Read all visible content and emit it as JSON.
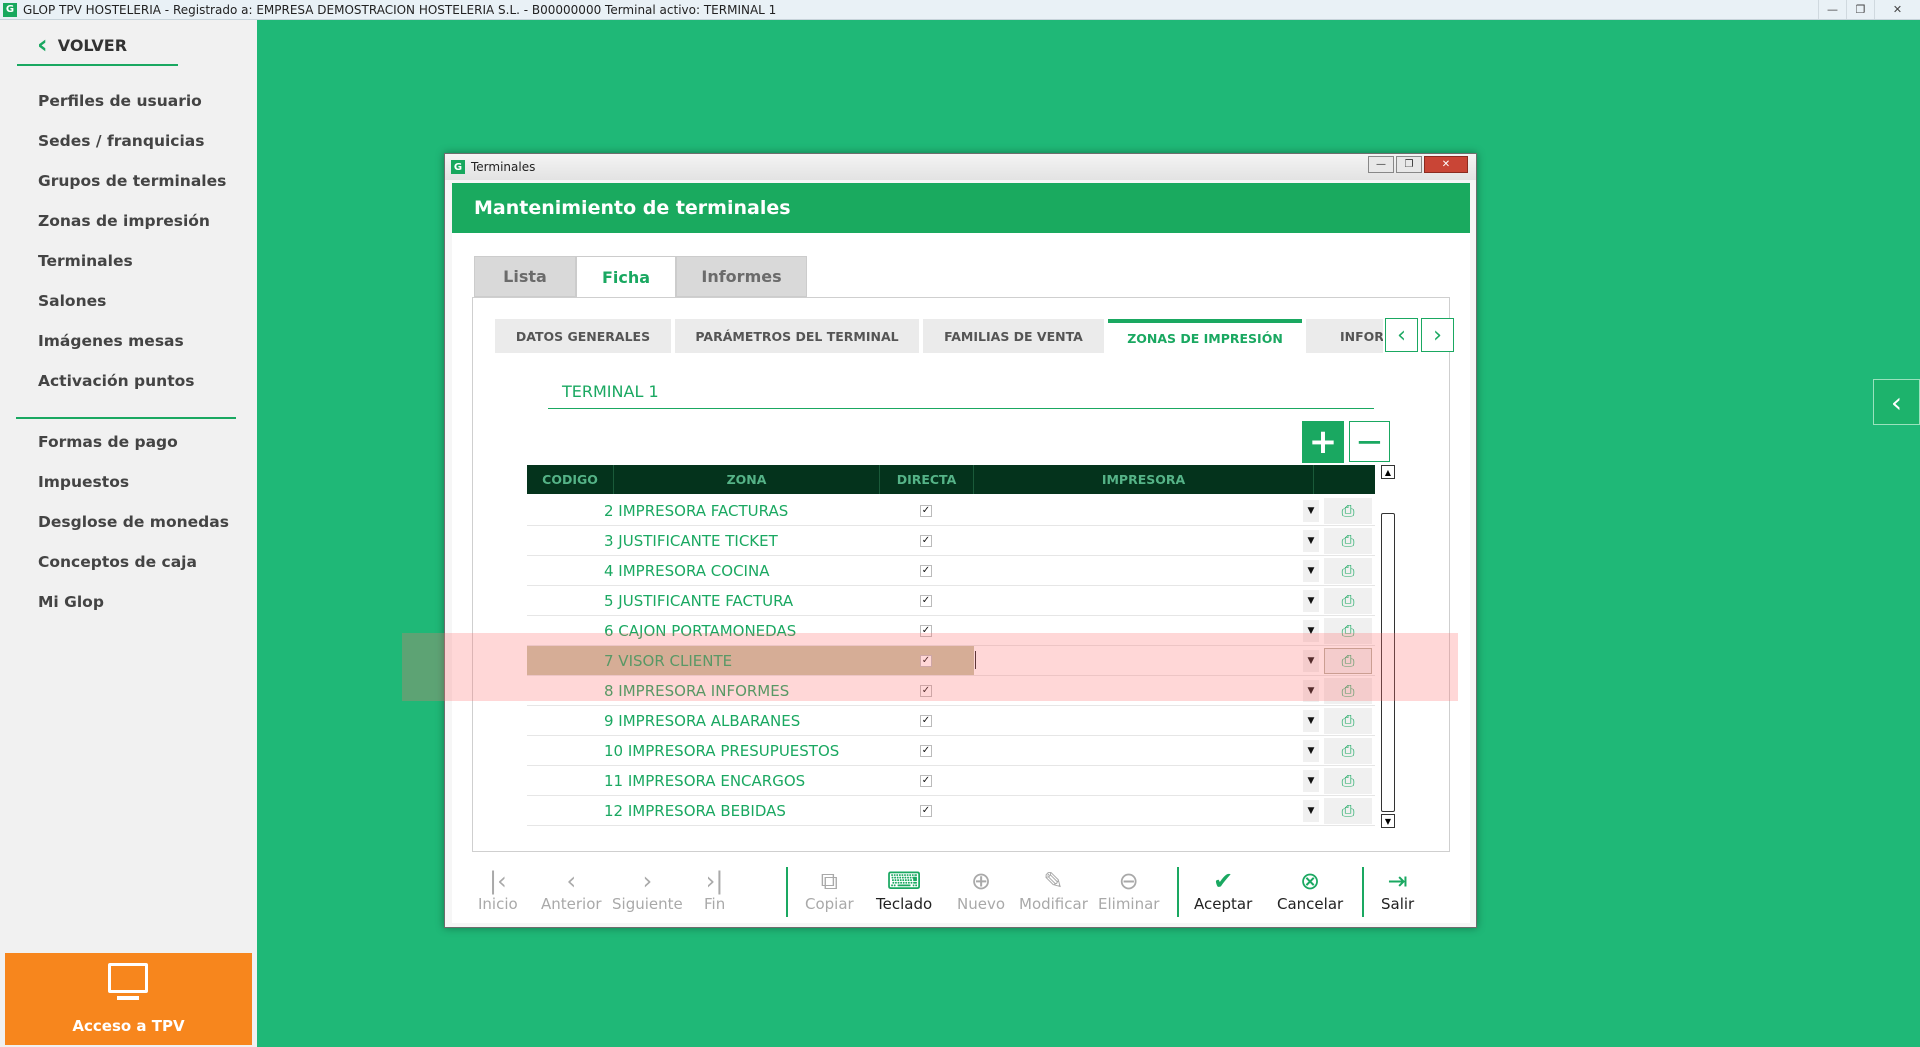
{
  "window": {
    "title": "GLOP TPV HOSTELERIA -  Registrado a: EMPRESA DEMOSTRACION  HOSTELERIA S.L. - B00000000  Terminal activo: TERMINAL 1",
    "app_icon": "G",
    "minimize": "—",
    "maximize": "❐",
    "close": "✕"
  },
  "sidebar": {
    "back_label": "VOLVER",
    "group1": [
      "Perfiles de usuario",
      "Sedes / franquicias",
      "Grupos de terminales",
      "Zonas de impresión",
      "Terminales",
      "Salones",
      "Imágenes mesas",
      "Activación puntos"
    ],
    "group2": [
      "Formas de pago",
      "Impuestos",
      "Desglose de monedas",
      "Conceptos de caja",
      "Mi Glop"
    ],
    "tpv_label": "Acceso a TPV"
  },
  "dialog": {
    "title": "Terminales",
    "app_icon": "G",
    "header": "Mantenimiento de terminales",
    "main_tabs": [
      "Lista",
      "Ficha",
      "Informes"
    ],
    "active_main_tab": "Ficha",
    "sub_tabs": [
      "DATOS GENERALES",
      "PARÁMETROS DEL TERMINAL",
      "FAMILIAS DE VENTA",
      "ZONAS DE IMPRESIÓN",
      "INFORM"
    ],
    "active_sub_tab": "ZONAS DE IMPRESIÓN",
    "terminal_name": "TERMINAL 1",
    "grid": {
      "columns": [
        "CODIGO",
        "ZONA",
        "DIRECTA",
        "IMPRESORA"
      ],
      "rows": [
        {
          "zona": "2 IMPRESORA FACTURAS",
          "directa": true
        },
        {
          "zona": "3 JUSTIFICANTE TICKET",
          "directa": true
        },
        {
          "zona": "4 IMPRESORA COCINA",
          "directa": true
        },
        {
          "zona": "5 JUSTIFICANTE FACTURA",
          "directa": true
        },
        {
          "zona": "6 CAJON PORTAMONEDAS",
          "directa": true
        },
        {
          "zona": "7 VISOR CLIENTE",
          "directa": true,
          "selected": true
        },
        {
          "zona": "8 IMPRESORA INFORMES",
          "directa": true
        },
        {
          "zona": "9 IMPRESORA ALBARANES",
          "directa": true
        },
        {
          "zona": "10 IMPRESORA PRESUPUESTOS",
          "directa": true
        },
        {
          "zona": "11 IMPRESORA ENCARGOS",
          "directa": true
        },
        {
          "zona": "12 IMPRESORA BEBIDAS",
          "directa": true
        }
      ]
    },
    "toolbar": {
      "inicio": "Inicio",
      "anterior": "Anterior",
      "siguiente": "Siguiente",
      "fin": "Fin",
      "copiar": "Copiar",
      "teclado": "Teclado",
      "nuevo": "Nuevo",
      "modificar": "Modificar",
      "eliminar": "Eliminar",
      "aceptar": "Aceptar",
      "cancelar": "Cancelar",
      "salir": "Salir"
    }
  },
  "colors": {
    "accent": "#1aa861",
    "background": "#1fb877",
    "tpv_button": "#f7861d",
    "grid_header": "#04331c"
  }
}
